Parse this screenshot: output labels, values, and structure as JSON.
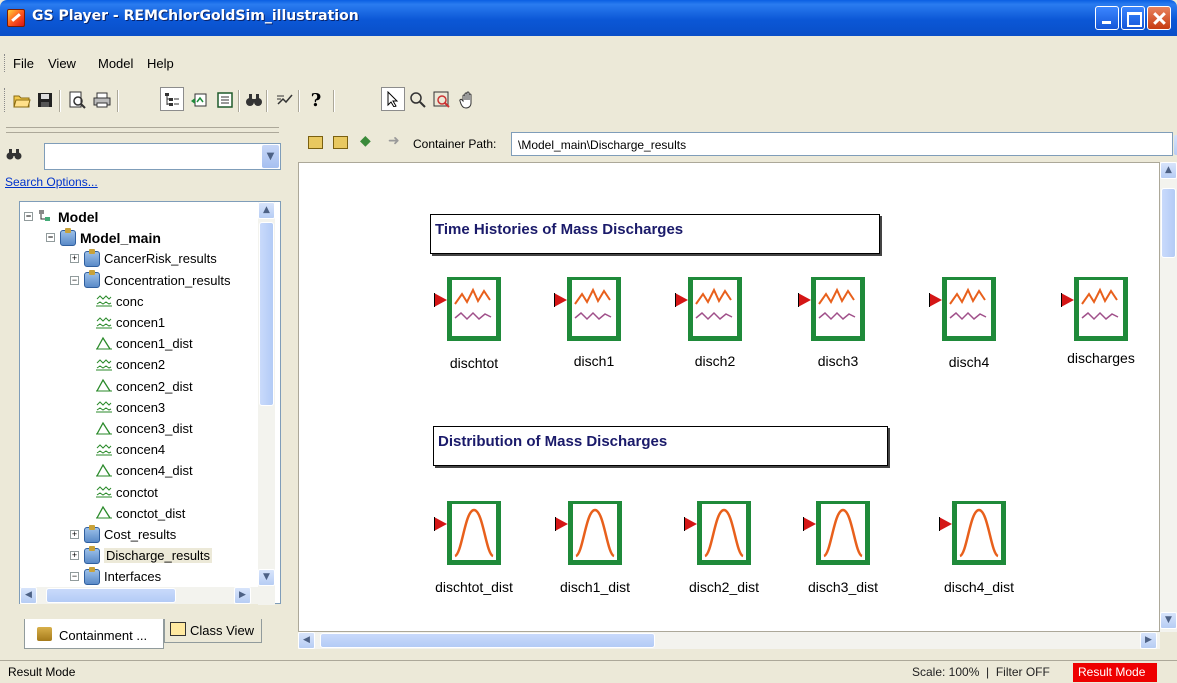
{
  "window": {
    "title": "GS Player - REMChlorGoldSim_illustration"
  },
  "menu": {
    "items": [
      "File",
      "View",
      "Model",
      "Help"
    ]
  },
  "left": {
    "search_placeholder": "",
    "search_options_label": "Search Options...",
    "tree": [
      {
        "label": "Model",
        "level": 0,
        "bold": true,
        "icon": "model-icon",
        "expander": "−"
      },
      {
        "label": "Model_main",
        "level": 1,
        "bold": true,
        "icon": "container-icon",
        "expander": "−"
      },
      {
        "label": "CancerRisk_results",
        "level": 2,
        "icon": "container-icon",
        "expander": "+"
      },
      {
        "label": "Concentration_results",
        "level": 2,
        "icon": "container-icon",
        "expander": "−"
      },
      {
        "label": "conc",
        "level": 3,
        "icon": "time-history-icon"
      },
      {
        "label": "concen1",
        "level": 3,
        "icon": "time-history-icon"
      },
      {
        "label": "concen1_dist",
        "level": 3,
        "icon": "distribution-icon"
      },
      {
        "label": "concen2",
        "level": 3,
        "icon": "time-history-icon"
      },
      {
        "label": "concen2_dist",
        "level": 3,
        "icon": "distribution-icon"
      },
      {
        "label": "concen3",
        "level": 3,
        "icon": "time-history-icon"
      },
      {
        "label": "concen3_dist",
        "level": 3,
        "icon": "distribution-icon"
      },
      {
        "label": "concen4",
        "level": 3,
        "icon": "time-history-icon"
      },
      {
        "label": "concen4_dist",
        "level": 3,
        "icon": "distribution-icon"
      },
      {
        "label": "conctot",
        "level": 3,
        "icon": "time-history-icon"
      },
      {
        "label": "conctot_dist",
        "level": 3,
        "icon": "distribution-icon"
      },
      {
        "label": "Cost_results",
        "level": 2,
        "icon": "container-icon",
        "expander": "+"
      },
      {
        "label": "Discharge_results",
        "level": 2,
        "icon": "container-icon",
        "expander": "+",
        "selected": true
      },
      {
        "label": "Interfaces",
        "level": 2,
        "icon": "container-icon",
        "expander": "−"
      }
    ],
    "tabs": {
      "containment": "Containment ...",
      "class_view": "Class View"
    }
  },
  "path": {
    "label": "Container Path:",
    "value": "\\Model_main\\Discharge_results"
  },
  "canvas": {
    "group1": {
      "title": "Time Histories of Mass Discharges"
    },
    "group2": {
      "title": "Distribution of Mass Discharges"
    },
    "time_history_elements": [
      "dischtot",
      "disch1",
      "disch2",
      "disch3",
      "disch4",
      "discharges"
    ],
    "distribution_elements": [
      "dischtot_dist",
      "disch1_dist",
      "disch2_dist",
      "disch3_dist",
      "disch4_dist"
    ]
  },
  "status": {
    "left": "Result Mode",
    "scale": "Scale: 100%",
    "filter": "Filter OFF",
    "mode": "Result Mode"
  },
  "colors": {
    "element_border": "#1f8a3a",
    "input_triangle": "#d41616",
    "result_mode_bg": "#ee0000",
    "titlebar": "#0a5fe3"
  }
}
